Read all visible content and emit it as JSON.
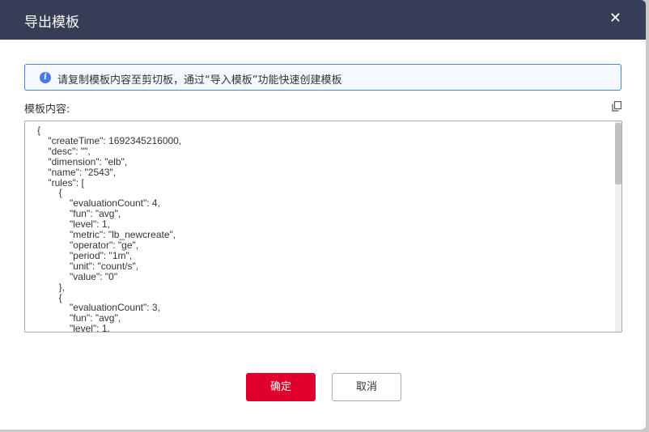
{
  "dialog": {
    "title": "导出模板",
    "close_icon": "close-icon",
    "alert": {
      "icon": "info-icon",
      "text": "请复制模板内容至剪切板，通过“导入模板”功能快速创建模板"
    },
    "content_label": "模板内容:",
    "copy_icon": "copy-icon",
    "content": "{\n    \"createTime\": 1692345216000,\n    \"desc\": \"\",\n    \"dimension\": \"elb\",\n    \"name\": \"2543\",\n    \"rules\": [\n        {\n            \"evaluationCount\": 4,\n            \"fun\": \"avg\",\n            \"level\": 1,\n            \"metric\": \"lb_newcreate\",\n            \"operator\": \"ge\",\n            \"period\": \"1m\",\n            \"unit\": \"count/s\",\n            \"value\": \"0\"\n        },\n        {\n            \"evaluationCount\": 3,\n            \"fun\": \"avg\",\n            \"level\": 1,\n            \"metric\": \"lb_newcreate\",\n            \"operator\": \"ge\",",
    "confirm_label": "确定",
    "cancel_label": "取消"
  },
  "colors": {
    "header": "#363e55",
    "primary": "#e1002d",
    "info": "#4679e8"
  }
}
